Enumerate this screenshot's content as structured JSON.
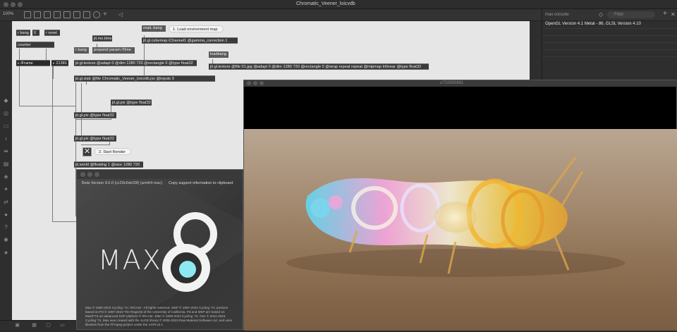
{
  "window": {
    "title": "Chromatic_Veener_loicvdb"
  },
  "toolbar": {
    "zoom": "100%"
  },
  "patch": {
    "objects": {
      "r_bang_1": "r bang",
      "num_zero": "0",
      "r_reset": "r reset",
      "counter": "counter",
      "iframe": "iFrame",
      "iframe_value": "21381",
      "jit_mo_time": "jit.mo.time",
      "r_bang_2": "r bang",
      "prepend": "prepend param iTime",
      "read_bang": "read, bang",
      "cubemap": "jit.gl.cubemap iChannel1 @gamma_correction 1",
      "texture1": "jit.gl.texture @adapt 0 @dim 1280 720 @rectangle 0 @type float32",
      "loadbang": "loadbang",
      "texture2": "jit.gl.texture @file 01.jpg @adapt 0 @dim 1280 720 @rectangle 0 @wrap repeat repeat @mipmap trilinear @type float32",
      "slab": "jit.gl.slab @file Chromatic_Veener_loicvdb.jxs @inputs 3",
      "pix_right": "jit.gl.pix @type float32",
      "pix_mid": "jit.gl.pix @type float32",
      "pix_low": "jit.gl.pix @type float32",
      "world": "jit.world @floating 1 @size 1280 720"
    },
    "comments": {
      "load_env": "1. Load environment map",
      "start_render": "2. Start Render"
    }
  },
  "console": {
    "title": "max console",
    "filter_placeholder": "Filter",
    "lines": [
      "OpenGL Version 4.1 Metal - 86, GLSL Version 4.10"
    ]
  },
  "render_window": {
    "title": "u732000861"
  },
  "about": {
    "version": "Beta Version 9.0.0 (cc20c6de33f) (arm64 mac)",
    "copy_link": "Copy support information to clipboard",
    "logo_text": "MAX",
    "logo_numeral": "8",
    "legal": "Max © 1990-2022 Cycling '74 / IRCAM - All rights reserved. MSP © 1997-2022 Cycling '74; portions based on Pd © 1997-2023 The Regents of the University of California. Pd and MSP are based on Max/FTS an advanced DSP platform © IRCAM. Jitter © 2000-2023 Cycling '74. Gen © 2011-2023 Cycling '74. Max was created with the JUCE library © 2005-2023 Raw Material Software Ltd. and uses libraries from the FFmpeg project under the LGPLv2.1"
  },
  "colors": {
    "accent_cyan": "#8ee8f2",
    "canvas_bg": "#e6e6e6",
    "object_bg": "#3b3b3b"
  }
}
